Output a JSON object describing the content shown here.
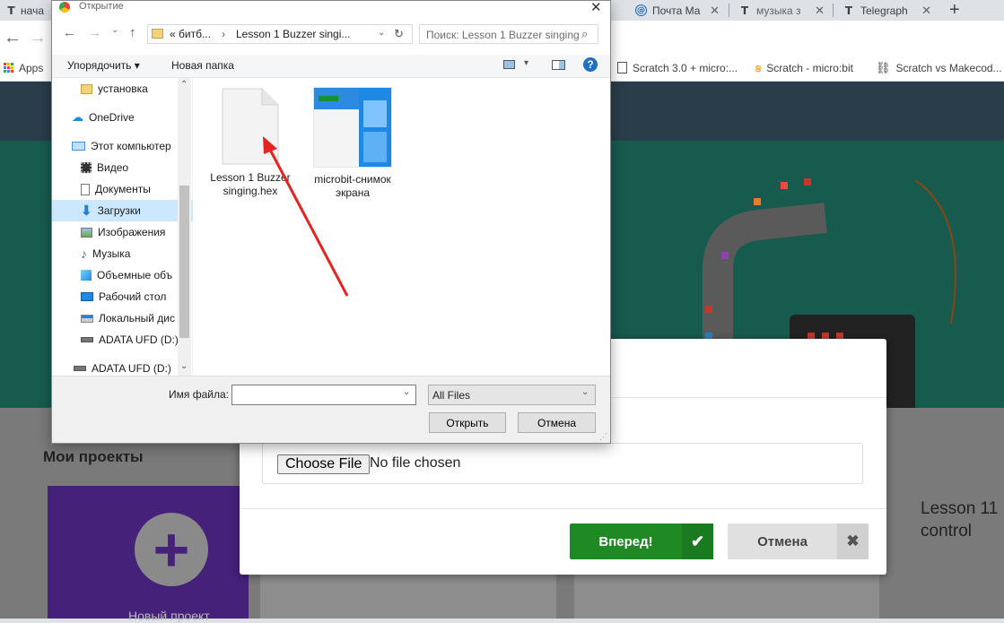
{
  "browser": {
    "tabs": [
      {
        "label": "нача",
        "favicon": "T"
      },
      {
        "label": "Почта Ма",
        "favicon": "@"
      },
      {
        "label": "музыка з",
        "favicon": "T"
      },
      {
        "label": "Telegraph",
        "favicon": "T"
      }
    ],
    "new_tab": "+",
    "bookmarks": [
      {
        "label": "Apps"
      },
      {
        "label": "Scratch 3.0 + micro:..."
      },
      {
        "label": "Scratch - micro:bit"
      },
      {
        "label": "Scratch vs Makecod..."
      }
    ]
  },
  "page": {
    "projects_title": "Мои проекты",
    "new_project_label": "Новый проект",
    "lesson_card_title": "Lesson 11\ncontrol"
  },
  "modal": {
    "choose_file": "Choose File",
    "no_file": "No file chosen",
    "go_label": "Вперед!",
    "cancel_label": "Отмена",
    "go_color": "#1f8a24"
  },
  "dialog": {
    "title": "Открытие",
    "breadcrumb": [
      "«  битб...",
      "Lesson 1 Buzzer singi..."
    ],
    "search_placeholder": "Поиск: Lesson 1 Buzzer singing",
    "organize": "Упорядочить",
    "new_folder": "Новая папка",
    "nav": [
      {
        "label": "установка",
        "icon": "folder-icon"
      },
      {
        "label": "OneDrive",
        "icon": "cloud-icon"
      },
      {
        "label": "Этот компьютер",
        "icon": "computer-icon"
      },
      {
        "label": "Видео",
        "icon": "video-icon"
      },
      {
        "label": "Документы",
        "icon": "document-icon"
      },
      {
        "label": "Загрузки",
        "icon": "download-icon",
        "selected": true
      },
      {
        "label": "Изображения",
        "icon": "image-icon"
      },
      {
        "label": "Музыка",
        "icon": "music-icon"
      },
      {
        "label": "Объемные объ",
        "icon": "cube-icon"
      },
      {
        "label": "Рабочий стол",
        "icon": "desktop-icon"
      },
      {
        "label": "Локальный дис",
        "icon": "disk-icon"
      },
      {
        "label": "ADATA UFD (D:)",
        "icon": "usb-icon"
      },
      {
        "label": "ADATA UFD (D:)",
        "icon": "usb-icon"
      }
    ],
    "files": [
      {
        "name": "Lesson 1 Buzzer\nsinging.hex",
        "type": "blank-file"
      },
      {
        "name": "microbit-снимок\nэкрана",
        "type": "image-thumb"
      }
    ],
    "filename_label": "Имя файла:",
    "filename_value": "",
    "filter": "All Files",
    "open_btn": "Открыть",
    "cancel_btn": "Отмена"
  }
}
